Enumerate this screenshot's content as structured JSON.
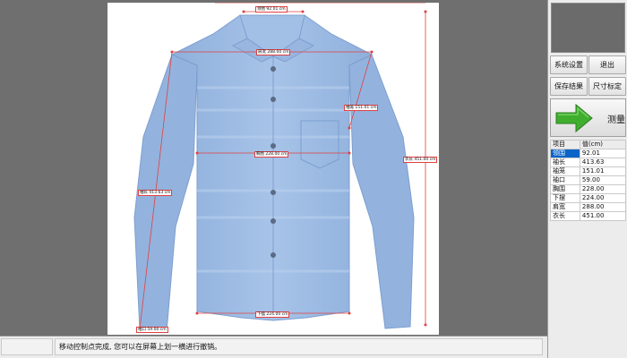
{
  "buttons": {
    "settings": "系统设置",
    "exit": "退出",
    "save": "保存结果",
    "calibrate": "尺寸标定",
    "measure": "测量"
  },
  "results": {
    "headers": [
      "项目",
      "值(cm)"
    ],
    "rows": [
      {
        "name": "领围",
        "value": "92.01"
      },
      {
        "name": "袖长",
        "value": "413.63"
      },
      {
        "name": "袖笼",
        "value": "151.01"
      },
      {
        "name": "袖口",
        "value": "59.00"
      },
      {
        "name": "胸围",
        "value": "228.00"
      },
      {
        "name": "下摆",
        "value": "224.00"
      },
      {
        "name": "肩宽",
        "value": "288.00"
      },
      {
        "name": "衣长",
        "value": "451.00"
      }
    ]
  },
  "measurements": {
    "collar": "领围 92.01 cm",
    "shoulder": "肩宽 288.00 cm",
    "armhole": "袖笼 151.01 cm",
    "chest": "胸围 228.00 cm",
    "sleeve": "袖长 413.63 cm",
    "length": "衣长 451.00 cm",
    "cuff": "袖口 59.00 cm",
    "hem": "下摆 224.00 cm"
  },
  "status": {
    "message": "移动控制点完成, 您可以在屏幕上划一横进行撤销。"
  },
  "colors": {
    "shirt": "#9fbde3",
    "measure_line": "#e04040",
    "selected": "#0a64c8",
    "arrow": "#3fae2e"
  },
  "icons": {
    "measure": "green-arrow-right-icon"
  }
}
